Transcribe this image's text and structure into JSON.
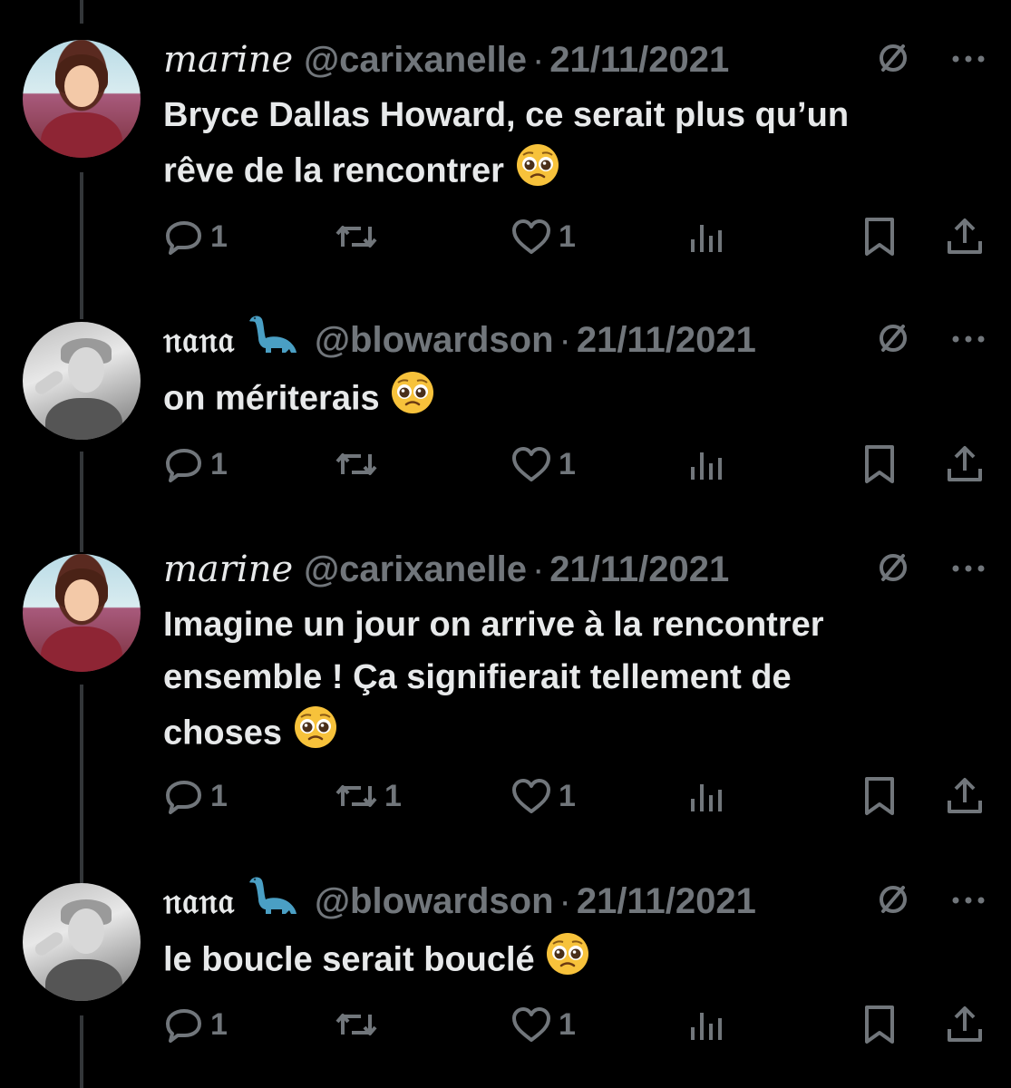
{
  "tweets": [
    {
      "display_name": "marine",
      "handle": "@carixanelle",
      "separator": "·",
      "date": "21/11/2021",
      "text_lines": [
        "Bryce Dallas Howard, ce serait plus qu’un",
        "rêve de la rencontrer"
      ],
      "reply_count": "1",
      "retweet_count": "",
      "like_count": "1"
    },
    {
      "display_name": "𝔫𝔞𝔫𝔞",
      "name_emoji": "sauropod-emoji",
      "handle": "@blowardson",
      "separator": "·",
      "date": "21/11/2021",
      "text_lines": [
        "on mériterais"
      ],
      "reply_count": "1",
      "retweet_count": "",
      "like_count": "1"
    },
    {
      "display_name": "marine",
      "handle": "@carixanelle",
      "separator": "·",
      "date": "21/11/2021",
      "text_lines": [
        "Imagine un jour on arrive à la rencontrer",
        "ensemble ! Ça signifierait tellement de",
        "choses"
      ],
      "reply_count": "1",
      "retweet_count": "1",
      "like_count": "1"
    },
    {
      "display_name": "𝔫𝔞𝔫𝔞",
      "name_emoji": "sauropod-emoji",
      "handle": "@blowardson",
      "separator": "·",
      "date": "21/11/2021",
      "text_lines": [
        "le boucle serait bouclé"
      ],
      "reply_count": "1",
      "retweet_count": "",
      "like_count": "1"
    }
  ],
  "icons": {
    "text_emoji": "pleading-face-emoji",
    "header": [
      "grok-icon",
      "more-options-icon"
    ],
    "actions": [
      "reply-icon",
      "retweet-icon",
      "like-icon",
      "views-icon",
      "bookmark-icon",
      "share-icon"
    ]
  },
  "colors": {
    "background": "#000000",
    "text": "#e7e9ea",
    "muted": "#71767b",
    "thread_line": "#333639"
  }
}
